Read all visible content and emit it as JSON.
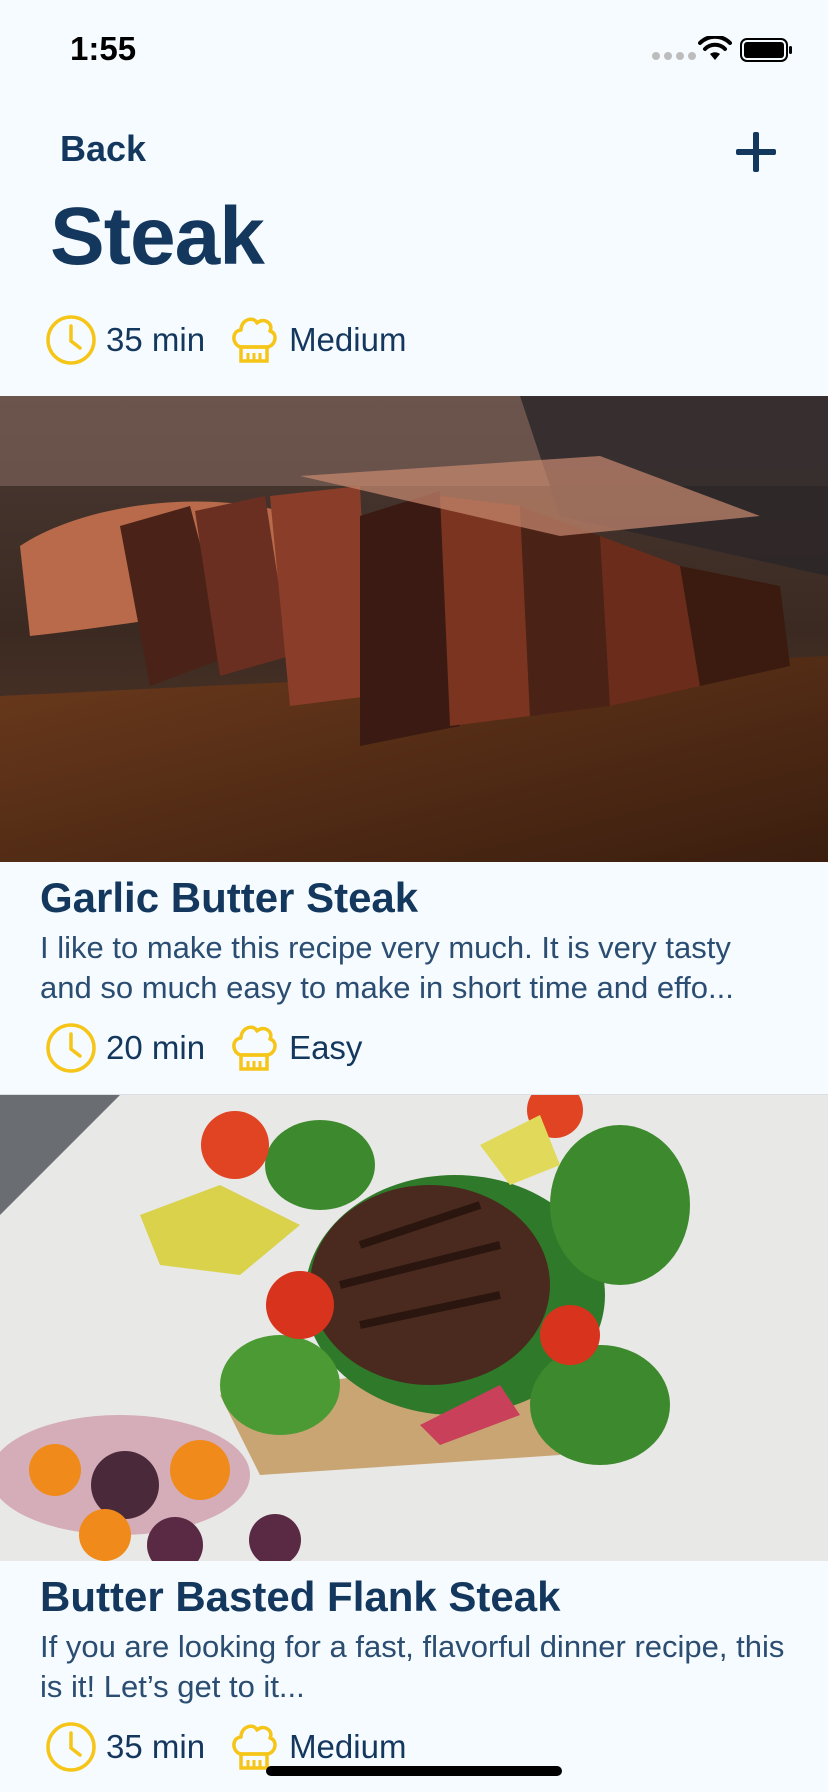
{
  "status": {
    "time": "1:55"
  },
  "nav": {
    "back_label": "Back",
    "title": "Steak"
  },
  "partial_item": {
    "time": "35 min",
    "difficulty": "Medium"
  },
  "recipes": [
    {
      "title": "Garlic Butter Steak",
      "description": "I like to make this recipe very much. It is very tasty and so much easy to make in short time and effo...",
      "time": "20 min",
      "difficulty": "Easy",
      "image": "sliced-steak-photo"
    },
    {
      "title": "Butter Basted Flank Steak",
      "description": "If you are looking for a fast, flavorful dinner recipe, this is it! Let’s get to it...",
      "time": "35 min",
      "difficulty": "Medium",
      "image": "steak-salad-plate-photo"
    }
  ],
  "colors": {
    "accent": "#f5c518",
    "text": "#14375e",
    "background": "#f5fbff"
  },
  "icons": {
    "time": "clock-icon",
    "difficulty": "chef-hat-icon",
    "add": "plus-icon"
  }
}
